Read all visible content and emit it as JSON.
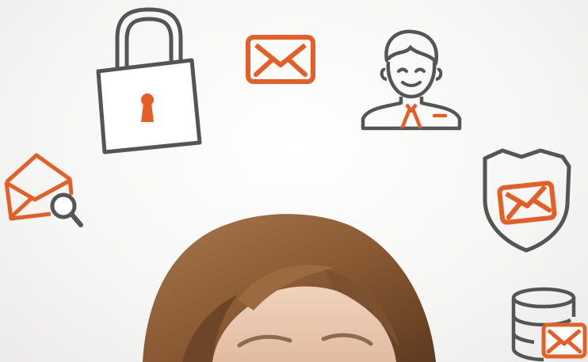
{
  "colors": {
    "accent": "#e35f26",
    "outline": "#555555",
    "hair": "#8a5a34",
    "skin": "#e8c6ad"
  },
  "icons": [
    "lock-icon",
    "envelope-icon",
    "businessman-icon",
    "open-envelope-search-icon",
    "shield-envelope-icon",
    "database-envelope-icon"
  ]
}
